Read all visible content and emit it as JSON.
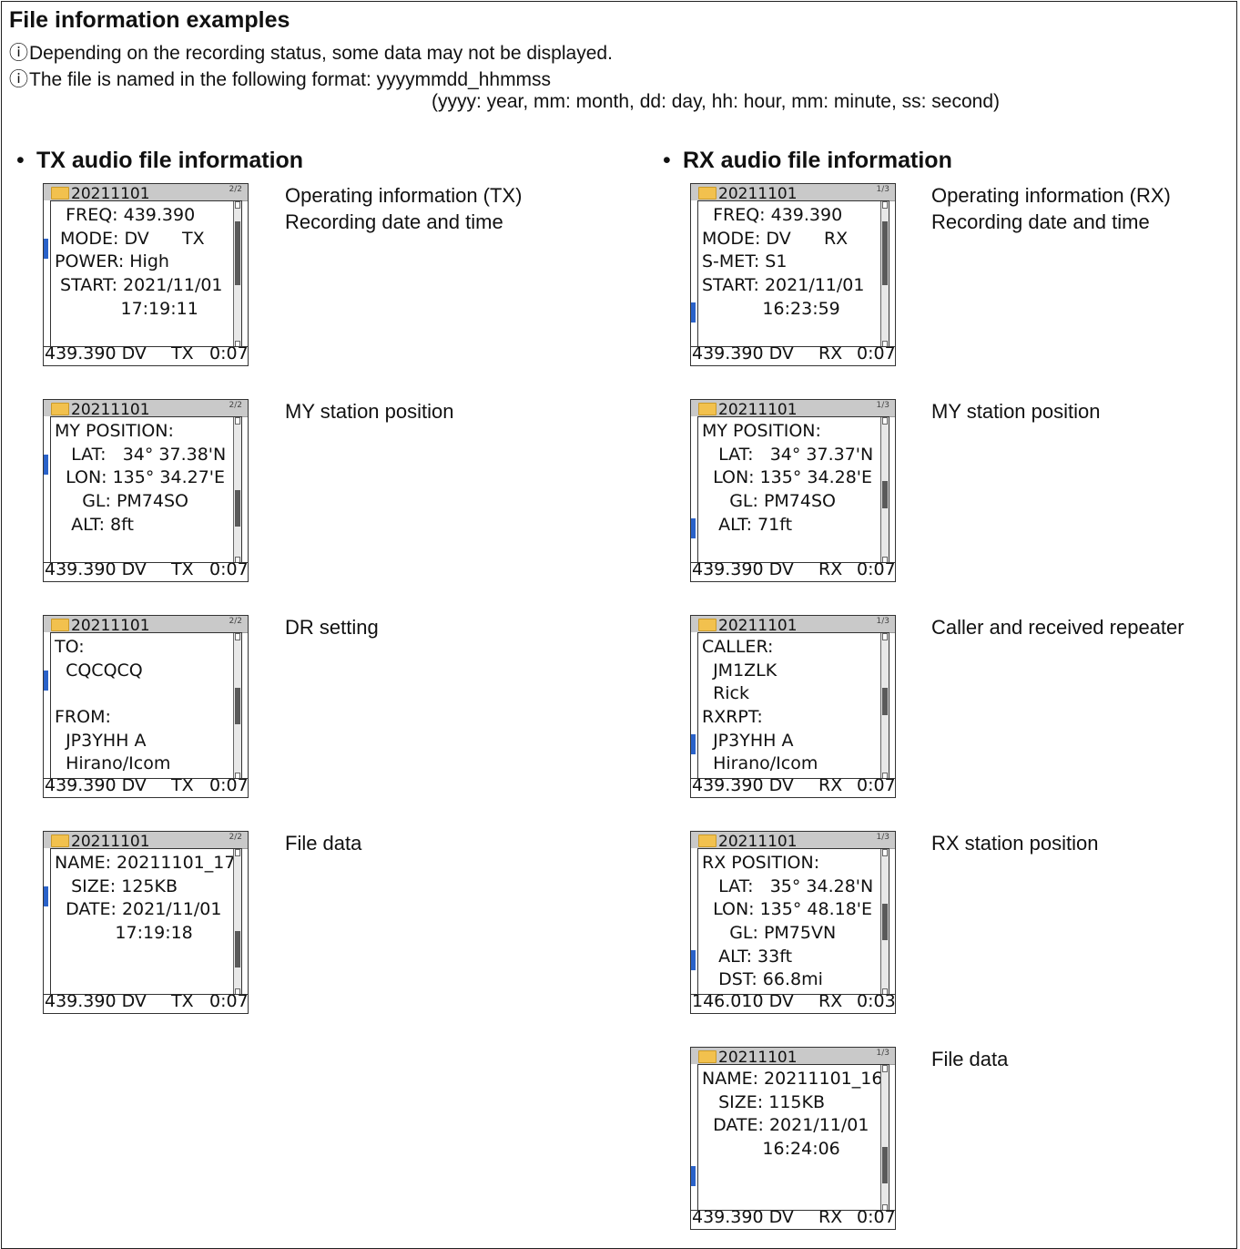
{
  "title": "File information examples",
  "notes": [
    "Depending on the recording status, some data may not be displayed.",
    "The file is named in the following format: yyyymmdd_hhmmss"
  ],
  "note_detail": "(yyyy: year, mm: month, dd: day, hh: hour, mm: minute, ss: second)",
  "info_icon": "ⓘ",
  "bullet": "•",
  "tx_section": "TX audio file information",
  "rx_section": "RX audio file information",
  "colors": {
    "folder": "#f2c14e",
    "accent_blue": "#2a62c9",
    "lcd_header": "#c9c9c9"
  },
  "screens": {
    "tx1": {
      "folder": "20211101",
      "corner": "2/2",
      "lines": [
        "  FREQ: 439.390",
        " MODE: DV      TX",
        "POWER: High",
        " START: 2021/11/01",
        "            17:19:11"
      ],
      "bottom_freq": "439.390 DV",
      "bottom_dir": "TX",
      "bottom_time": "0:07",
      "desc": [
        "Operating information (TX)",
        "Recording date and time"
      ]
    },
    "tx2": {
      "folder": "20211101",
      "corner": "2/2",
      "lines": [
        "MY POSITION:",
        "   LAT:   34° 37.38'N",
        "  LON: 135° 34.27'E",
        "     GL: PM74SO",
        "   ALT: 8ft"
      ],
      "bottom_freq": "439.390 DV",
      "bottom_dir": "TX",
      "bottom_time": "0:07",
      "desc": [
        "MY station position"
      ]
    },
    "tx3": {
      "folder": "20211101",
      "corner": "2/2",
      "lines": [
        "TO:",
        "  CQCQCQ",
        "",
        "FROM:",
        "  JP3YHH A",
        "  Hirano/Icom"
      ],
      "bottom_freq": "439.390 DV",
      "bottom_dir": "TX",
      "bottom_time": "0:07",
      "desc": [
        "DR setting"
      ]
    },
    "tx4": {
      "folder": "20211101",
      "corner": "2/2",
      "lines": [
        "NAME: 20211101_17",
        "   SIZE: 125KB",
        "  DATE: 2021/11/01",
        "           17:19:18"
      ],
      "bottom_freq": "439.390 DV",
      "bottom_dir": "TX",
      "bottom_time": "0:07",
      "desc": [
        "File data"
      ]
    },
    "rx1": {
      "folder": "20211101",
      "corner": "1/3",
      "lines": [
        "  FREQ: 439.390",
        "MODE: DV      RX",
        "S-MET: S1",
        "START: 2021/11/01",
        "           16:23:59"
      ],
      "bottom_freq": "439.390 DV",
      "bottom_dir": "RX",
      "bottom_time": "0:07",
      "desc": [
        "Operating information (RX)",
        "Recording date and time"
      ]
    },
    "rx2": {
      "folder": "20211101",
      "corner": "1/3",
      "lines": [
        "MY POSITION:",
        "   LAT:   34° 37.37'N",
        "  LON: 135° 34.28'E",
        "     GL: PM74SO",
        "   ALT: 71ft"
      ],
      "bottom_freq": "439.390 DV",
      "bottom_dir": "RX",
      "bottom_time": "0:07",
      "desc": [
        "MY station position"
      ]
    },
    "rx3": {
      "folder": "20211101",
      "corner": "1/3",
      "lines": [
        "CALLER:",
        "  JM1ZLK",
        "  Rick",
        "RXRPT:",
        "  JP3YHH A",
        "  Hirano/Icom"
      ],
      "bottom_freq": "439.390 DV",
      "bottom_dir": "RX",
      "bottom_time": "0:07",
      "desc": [
        "Caller and received repeater"
      ]
    },
    "rx4": {
      "folder": "20211101",
      "corner": "1/3",
      "lines": [
        "RX POSITION:",
        "   LAT:   35° 34.28'N",
        "  LON: 135° 48.18'E",
        "     GL: PM75VN",
        "   ALT: 33ft",
        "   DST: 66.8mi"
      ],
      "bottom_freq": "146.010 DV",
      "bottom_dir": "RX",
      "bottom_time": "0:03",
      "desc": [
        "RX station position"
      ]
    },
    "rx5": {
      "folder": "20211101",
      "corner": "1/3",
      "lines": [
        "NAME: 20211101_16",
        "   SIZE: 115KB",
        "  DATE: 2021/11/01",
        "           16:24:06"
      ],
      "bottom_freq": "439.390 DV",
      "bottom_dir": "RX",
      "bottom_time": "0:07",
      "desc": [
        "File data"
      ]
    }
  }
}
